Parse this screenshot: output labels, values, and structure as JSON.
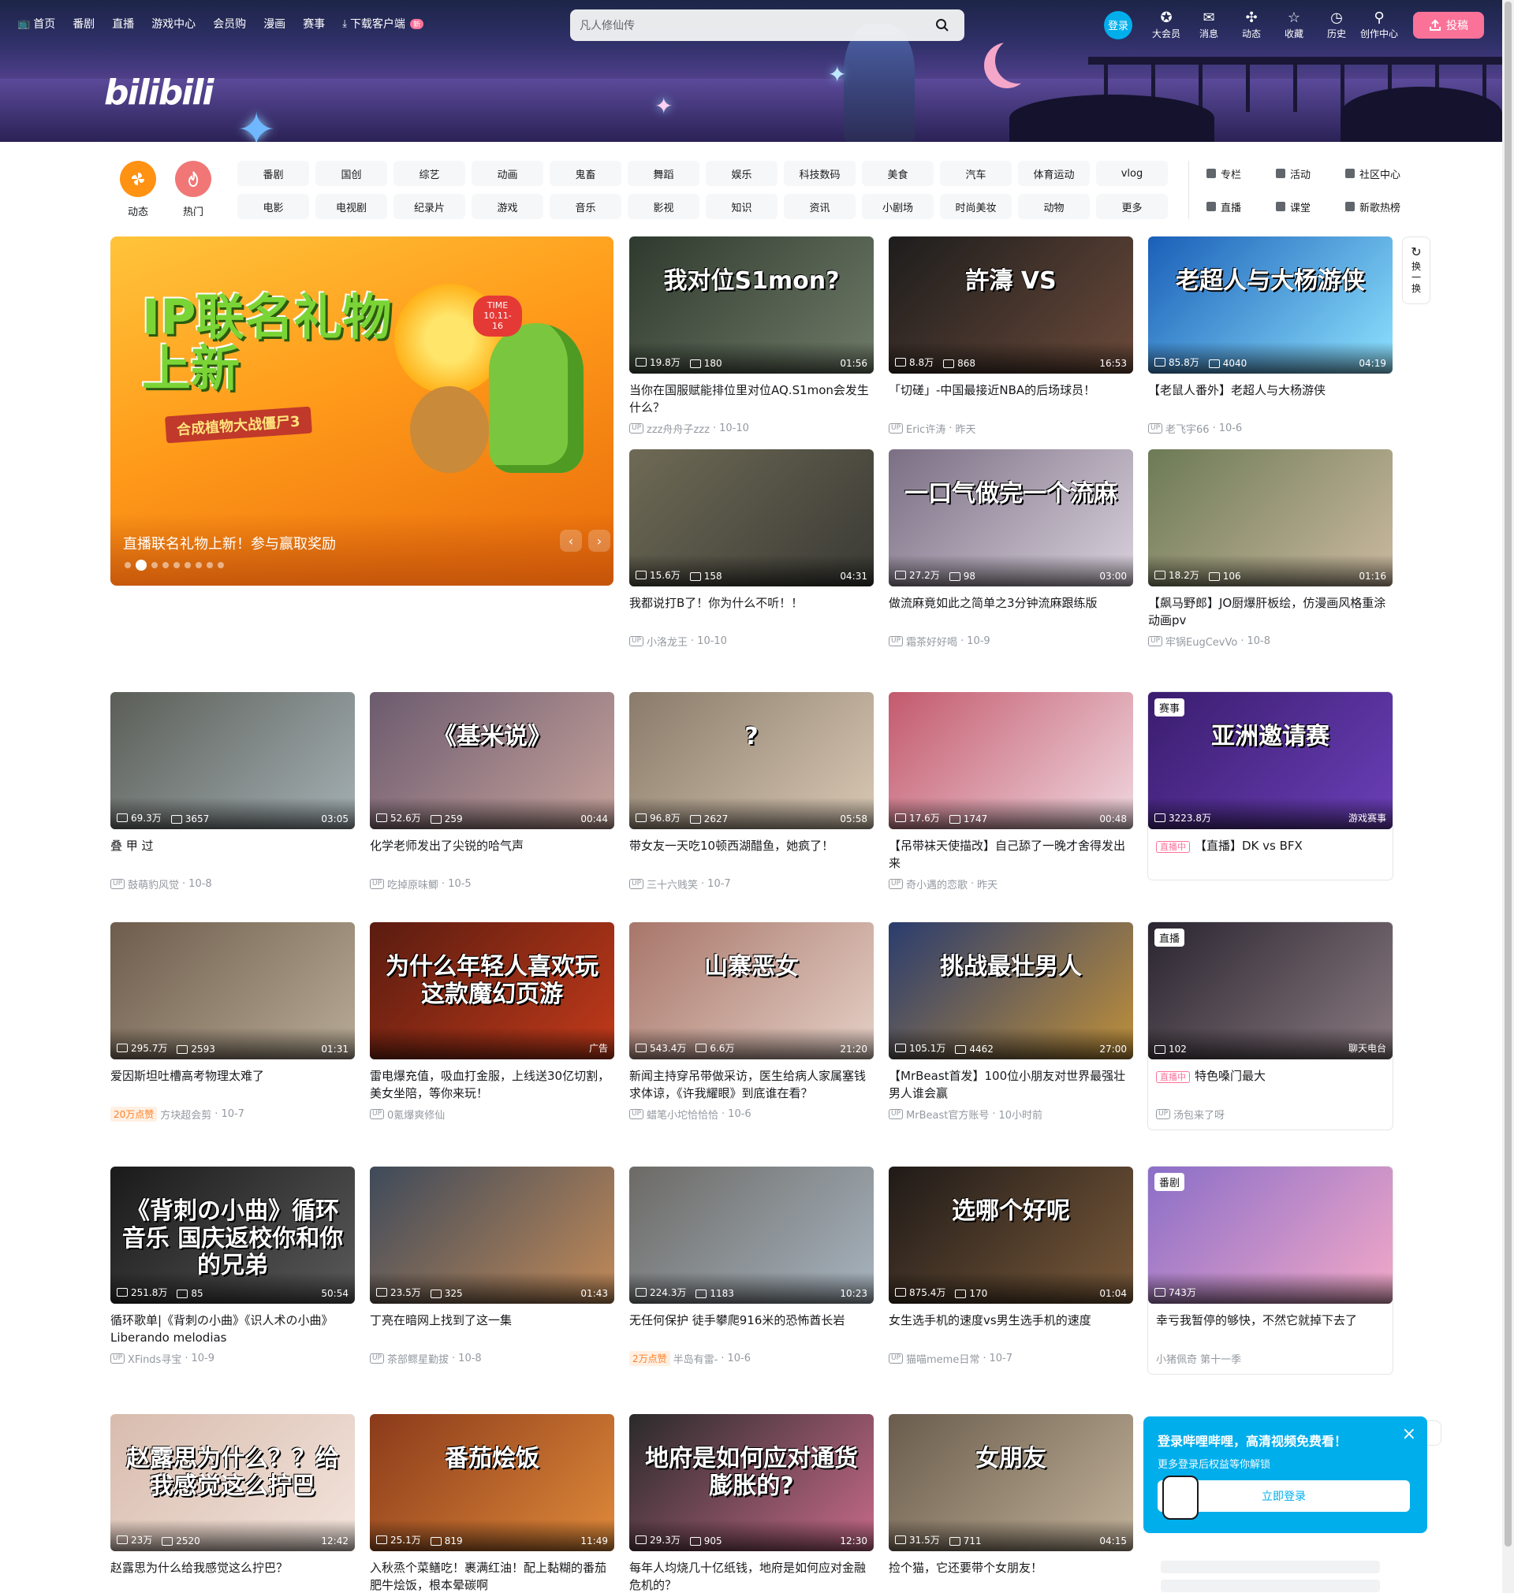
{
  "header": {
    "nav": [
      {
        "label": "首页",
        "icon": "tv-icon"
      },
      {
        "label": "番剧"
      },
      {
        "label": "直播"
      },
      {
        "label": "游戏中心"
      },
      {
        "label": "会员购"
      },
      {
        "label": "漫画"
      },
      {
        "label": "赛事"
      },
      {
        "label": "下载客户端",
        "icon": "download-icon",
        "badge": "新"
      }
    ],
    "search_placeholder": "凡人修仙传",
    "login": "登录",
    "right_nav": [
      {
        "label": "大会员",
        "icon": "vip-icon"
      },
      {
        "label": "消息",
        "icon": "message-icon"
      },
      {
        "label": "动态",
        "icon": "dynamic-icon"
      },
      {
        "label": "收藏",
        "icon": "star-icon"
      },
      {
        "label": "历史",
        "icon": "history-icon"
      },
      {
        "label": "创作中心",
        "icon": "bulb-icon"
      }
    ],
    "upload": "投稿",
    "logo": "bilibili"
  },
  "channel": {
    "dynamic": "动态",
    "hot": "热门",
    "tags": [
      "番剧",
      "国创",
      "综艺",
      "动画",
      "鬼畜",
      "舞蹈",
      "娱乐",
      "科技数码",
      "美食",
      "汽车",
      "体育运动",
      "vlog",
      "电影",
      "电视剧",
      "纪录片",
      "游戏",
      "音乐",
      "影视",
      "知识",
      "资讯",
      "小剧场",
      "时尚美妆",
      "动物",
      "更多"
    ],
    "more": [
      "专栏",
      "活动",
      "社区中心",
      "直播",
      "课堂",
      "新歌热榜"
    ]
  },
  "carousel": {
    "title": "直播联名礼物上新！参与赢取奖励",
    "art_title": "IP联名礼物上新",
    "art_sub": "合成植物大战僵尸3",
    "art_time": "TIME 10.11-16",
    "dot_count": 9,
    "active_dot": 1
  },
  "refresh": {
    "label": "换一换"
  },
  "videos": [
    {
      "thumb_text": "我对位S1mon?",
      "play": "19.8万",
      "danmaku": "180",
      "dur": "01:56",
      "title": "当你在国服赋能排位里对位AQ.S1mon会发生什么？",
      "author": "zzz舟舟子zzz",
      "date": "10-10",
      "bg": "#2f3a2e",
      "bg2": "#6f7b68"
    },
    {
      "thumb_text": "許濤 VS",
      "play": "8.8万",
      "danmaku": "868",
      "dur": "16:53",
      "title": "「切磋」-中国最接近NBA的后场球员！",
      "author": "Eric许涛",
      "date": "昨天",
      "bg": "#1d1d1d",
      "bg2": "#6b4a3a"
    },
    {
      "thumb_text": "老超人与大杨游侠",
      "play": "85.8万",
      "danmaku": "4040",
      "dur": "04:19",
      "title": "【老鼠人番外】老超人与大杨游侠",
      "author": "老飞宇66",
      "date": "10-6",
      "bg": "#1a5fb8",
      "bg2": "#8ee3ff"
    },
    {
      "thumb_text": "",
      "play": "15.6万",
      "danmaku": "158",
      "dur": "04:31",
      "title": "我都说打B了！你为什么不听！！",
      "author": "小洛龙王",
      "date": "10-10",
      "bg": "#6e6a55",
      "bg2": "#3a3a35"
    },
    {
      "thumb_text": "一口气做完一个流麻",
      "play": "27.2万",
      "danmaku": "98",
      "dur": "03:00",
      "title": "做流麻竟如此之简单之3分钟流麻跟练版",
      "author": "霜茶好好喝",
      "date": "10-9",
      "bg": "#7b6f84",
      "bg2": "#d9d1dc"
    },
    {
      "thumb_text": "",
      "play": "18.2万",
      "danmaku": "106",
      "dur": "01:16",
      "title": "【飙马野郎】JO厨爆肝板绘，仿漫画风格重涂动画pv",
      "author": "牢锅EugCevVo",
      "date": "10-8",
      "bg": "#6c7a55",
      "bg2": "#cbb9a0"
    },
    {
      "thumb_text": "",
      "play": "69.3万",
      "danmaku": "3657",
      "dur": "03:05",
      "title": "叠 甲 过",
      "author": "鼓萌豹风觉",
      "date": "10-8",
      "bg": "#5b5e57",
      "bg2": "#a4b0b4"
    },
    {
      "thumb_text": "《基米说》",
      "play": "52.6万",
      "danmaku": "259",
      "dur": "00:44",
      "title": "化学老师发出了尖锐的哈气声",
      "author": "吃掉原味鲫",
      "date": "10-5",
      "bg": "#6b5a6e",
      "bg2": "#c7a39c"
    },
    {
      "thumb_text": "?",
      "play": "96.8万",
      "danmaku": "2627",
      "dur": "05:58",
      "title": "带女友一天吃10顿西湖醋鱼，她疯了！",
      "author": "三十六贱笑",
      "date": "10-7",
      "bg": "#8a7b6a",
      "bg2": "#d8c8b4"
    },
    {
      "thumb_text": "",
      "play": "17.6万",
      "danmaku": "1747",
      "dur": "00:48",
      "title": "【吊带袜天使描改】自己舔了一晚才舍得发出来",
      "author": "奇小遇的恋歌",
      "date": "昨天",
      "bg": "#c35a6d",
      "bg2": "#f0d7df"
    },
    {
      "thumb_text": "亚洲邀请赛",
      "tag": "赛事",
      "play": "3223.8万",
      "danmaku": "",
      "dur": "游戏赛事",
      "title": "【直播】DK vs BFX",
      "live": "直播中",
      "author": "",
      "date": "",
      "bg": "#3a1d6e",
      "bg2": "#6b3fb8",
      "box": true
    },
    {
      "thumb_text": "",
      "play": "295.7万",
      "danmaku": "2593",
      "dur": "01:31",
      "title": "爱因斯坦吐槽高考物理太难了",
      "likes": "20万点赞",
      "author": "方块超会剪",
      "date": "10-7",
      "bg": "#6e5c4c",
      "bg2": "#b8ab96"
    },
    {
      "thumb_text": "为什么年轻人喜欢玩这款魔幻页游",
      "play": "",
      "danmaku": "",
      "dur": "广告",
      "title": "雷电爆充值，吸血打金服，上线送30亿切割，美女坐陪，等你来玩！",
      "author": "0氪爆爽修仙",
      "date": "",
      "bg": "#5a1c10",
      "bg2": "#c23a1a",
      "ad": true
    },
    {
      "thumb_text": "山寨恶女",
      "play": "543.4万",
      "danmaku": "6.6万",
      "dur": "21:20",
      "title": "新闻主持穿吊带做采访，医生给病人家属塞钱求体谅，《许我耀眼》到底谁在看？",
      "author": "蜡笔小坨恰恰恰",
      "date": "10-6",
      "bg": "#a8766a",
      "bg2": "#e5d0c6"
    },
    {
      "thumb_text": "挑战最壮男人",
      "play": "105.1万",
      "danmaku": "4462",
      "dur": "27:00",
      "title": "【MrBeast首发】100位小朋友对世界最强壮男人谁会赢",
      "author": "MrBeast官方账号",
      "date": "10小时前",
      "bg": "#2a3c6e",
      "bg2": "#c0903a"
    },
    {
      "thumb_text": "",
      "tag": "直播",
      "play": "102",
      "danmaku": "",
      "dur": "聊天电台",
      "title": "特色嗓门最大",
      "live": "直播中",
      "author": "汤包来了呀",
      "date": "",
      "bg": "#2a2530",
      "bg2": "#8a7a80",
      "box": true,
      "view": true
    },
    {
      "thumb_text": "《背刺の小曲》循环 音乐 国庆返校你和你的兄弟",
      "play": "251.8万",
      "danmaku": "85",
      "dur": "50:54",
      "title": "循环歌单|《背刺の小曲》《识人术の小曲》Liberando melodias",
      "author": "XFinds寻宝",
      "date": "10-9",
      "bg": "#1a1a1a",
      "bg2": "#5a5a5a"
    },
    {
      "thumb_text": "",
      "play": "23.5万",
      "danmaku": "325",
      "dur": "01:43",
      "title": "丁亮在暗网上找到了这一集",
      "author": "茶部鳏星勤拔",
      "date": "10-8",
      "bg": "#3e4a5a",
      "bg2": "#c28a58"
    },
    {
      "thumb_text": "",
      "play": "224.3万",
      "danmaku": "1183",
      "dur": "10:23",
      "title": "无任何保护 徒手攀爬916米的恐怖酋长岩",
      "likes": "2万点赞",
      "author": "半岛有雷-",
      "date": "10-6",
      "bg": "#6c6a66",
      "bg2": "#a7b4bf"
    },
    {
      "thumb_text": "选哪个好呢",
      "play": "875.4万",
      "danmaku": "170",
      "dur": "01:04",
      "title": "女生选手机的速度vs男生选手机的速度",
      "author": "猫喵meme日常",
      "date": "10-7",
      "bg": "#1f1a18",
      "bg2": "#7a5a3a"
    },
    {
      "thumb_text": "",
      "tag": "番剧",
      "play": "743万",
      "danmaku": "",
      "dur": "",
      "title": "幸亏我暂停的够快，不然它就掉下去了",
      "author": "小猪佩奇 第十一季",
      "date": "",
      "bg": "#8a6ec8",
      "bg2": "#f3a9c8",
      "box": true,
      "view": true,
      "noup": true
    },
    {
      "thumb_text": "赵露思为什么？？给我感觉这么拧巴",
      "play": "23万",
      "danmaku": "2520",
      "dur": "12:42",
      "title": "赵露思为什么给我感觉这么拧巴？",
      "author": "",
      "date": "",
      "bg": "#d8bcae",
      "bg2": "#f3e4dc"
    },
    {
      "thumb_text": "番茄烩饭",
      "play": "25.1万",
      "danmaku": "819",
      "dur": "11:49",
      "title": "入秋烝个菜鳝吃！裹满红油！配上黏糊的番茄肥牛烩饭，根本晕碳啊",
      "author": "",
      "date": "",
      "bg": "#8a3a1a",
      "bg2": "#e08a3a"
    },
    {
      "thumb_text": "地府是如何应对通货膨胀的?",
      "play": "29.3万",
      "danmaku": "905",
      "dur": "12:30",
      "title": "每年人均烧几十亿纸钱，地府是如何应对金融危机的？",
      "author": "",
      "date": "",
      "bg": "#2a2a2a",
      "bg2": "#c76a8a"
    },
    {
      "thumb_text": "女朋友",
      "play": "31.5万",
      "danmaku": "711",
      "dur": "04:15",
      "title": "捡个猫，它还要带个女朋友！",
      "author": "",
      "date": "",
      "bg": "#6a5c4c",
      "bg2": "#c2b29a"
    }
  ],
  "login_popup": {
    "title": "登录哔哩哔哩，高清视频免费看！",
    "sub": "更多登录后权益等你解锁",
    "button": "立即登录"
  }
}
